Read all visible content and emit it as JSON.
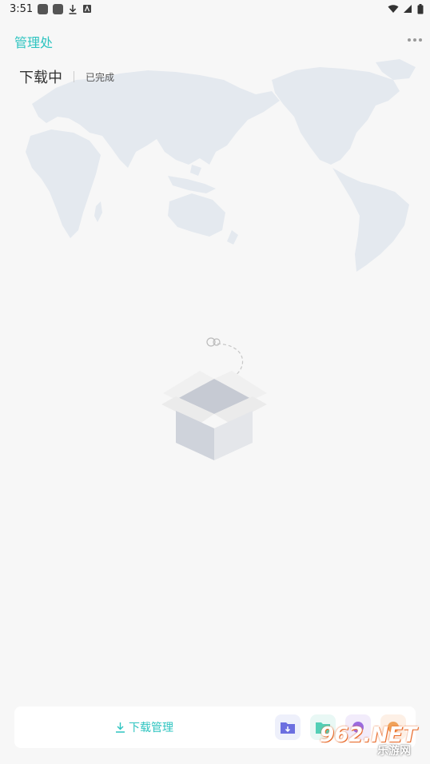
{
  "status_bar": {
    "time": "3:51"
  },
  "header": {
    "title": "管理处"
  },
  "tabs": [
    {
      "label": "下载中"
    },
    {
      "label": "已完成"
    }
  ],
  "bottom_bar": {
    "download_manage_label": "下载管理"
  },
  "watermark": {
    "main": "962.NET",
    "sub": "乐游网"
  },
  "colors": {
    "accent": "#2ec4c0",
    "map": "#e4e9ef",
    "background": "#f7f7f7"
  },
  "icons": [
    "download-icon",
    "folder-download-icon",
    "folder-icon",
    "purple-app-icon",
    "orange-app-icon",
    "more-icon"
  ]
}
